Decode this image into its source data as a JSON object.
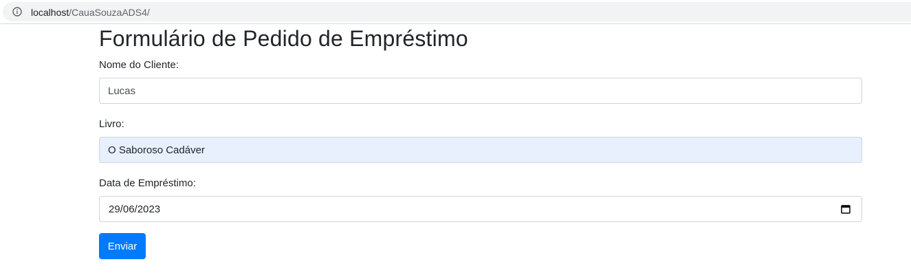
{
  "browser": {
    "url_host": "localhost",
    "url_path": "/CauaSouzaADS4/",
    "info_icon": "info-icon"
  },
  "form": {
    "title": "Formulário de Pedido de Empréstimo",
    "client_label": "Nome do Cliente:",
    "client_value": "Lucas",
    "book_label": "Livro:",
    "book_value": "O Saboroso Cadáver",
    "date_label": "Data de Empréstimo:",
    "date_value": "29/06/2023",
    "date_icon": "calendar-icon",
    "submit_label": "Enviar"
  },
  "colors": {
    "primary": "#007bff",
    "autofill_bg": "#e8f0fe",
    "input_border": "#ced4da"
  }
}
